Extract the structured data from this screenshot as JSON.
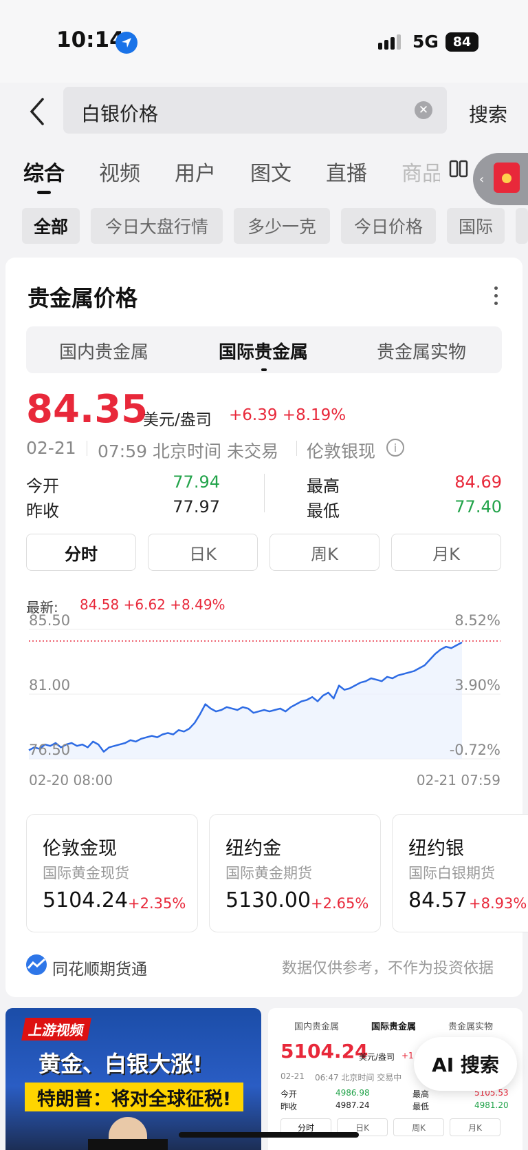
{
  "status_bar": {
    "time": "10:14",
    "network": "5G",
    "battery": "84"
  },
  "search": {
    "query": "白银价格",
    "submit_label": "搜索"
  },
  "tabs": [
    {
      "label": "综合",
      "active": true
    },
    {
      "label": "视频"
    },
    {
      "label": "用户"
    },
    {
      "label": "图文"
    },
    {
      "label": "直播"
    },
    {
      "label": "商品"
    }
  ],
  "chips": [
    {
      "label": "全部",
      "active": true
    },
    {
      "label": "今日大盘行情"
    },
    {
      "label": "多少一克"
    },
    {
      "label": "今日价格"
    },
    {
      "label": "国际"
    }
  ],
  "card": {
    "title": "贵金属价格",
    "segments": [
      "国内贵金属",
      "国际贵金属",
      "贵金属实物"
    ],
    "active_segment": "国际贵金属",
    "price": "84.35",
    "unit": "美元/盎司",
    "change": "+6.39 +8.19%",
    "date": "02-21",
    "time_status": "07:59 北京时间 未交易",
    "instrument": "伦敦银现",
    "stats": {
      "open_label": "今开",
      "open": "77.94",
      "prev_close_label": "昨收",
      "prev_close": "77.97",
      "high_label": "最高",
      "high": "84.69",
      "low_label": "最低",
      "low": "77.40"
    },
    "periods": [
      "分时",
      "日K",
      "周K",
      "月K"
    ],
    "active_period": "分时",
    "latest_label": "最新:",
    "latest_value": "84.58 +6.62 +8.49%",
    "footer_source": "同花顺期货通",
    "footer_note": "数据仅供参考，不作为投资依据"
  },
  "chart_data": {
    "type": "line",
    "x_start": "02-20 08:00",
    "x_end": "02-21 07:59",
    "y_ticks": [
      "85.50",
      "81.00",
      "76.50"
    ],
    "y_right_ticks": [
      "8.52%",
      "3.90%",
      "-0.72%"
    ],
    "ylim": [
      76.5,
      85.5
    ],
    "reference_line": 84.69,
    "series": [
      {
        "values": [
          77.1,
          77.3,
          77.2,
          77.5,
          77.4,
          77.6,
          77.3,
          77.5,
          77.6,
          77.4,
          77.5,
          77.3,
          77.7,
          77.5,
          77.0,
          77.3,
          77.4,
          77.5,
          77.6,
          77.8,
          77.7,
          77.9,
          78.0,
          78.1,
          78.0,
          78.2,
          78.3,
          78.2,
          78.5,
          78.4,
          78.6,
          79.0,
          79.6,
          80.3,
          80.0,
          79.8,
          79.9,
          80.1,
          80.0,
          79.9,
          80.1,
          80.0,
          79.7,
          79.8,
          79.9,
          79.8,
          79.9,
          80.0,
          79.8,
          80.1,
          80.3,
          80.5,
          80.6,
          80.8,
          80.5,
          80.9,
          81.1,
          80.7,
          81.6,
          81.3,
          81.4,
          81.6,
          81.8,
          81.9,
          82.1,
          82.0,
          81.9,
          82.2,
          82.1,
          82.3,
          82.4,
          82.5,
          82.6,
          82.8,
          83.0,
          83.4,
          83.8,
          84.1,
          84.3,
          84.2,
          84.4,
          84.6
        ]
      }
    ]
  },
  "markets": [
    {
      "title": "伦敦金现",
      "subtitle": "国际黄金现货",
      "value": "5104.24",
      "pct": "+2.35%"
    },
    {
      "title": "纽约金",
      "subtitle": "国际黄金期货",
      "value": "5130.00",
      "pct": "+2.65%"
    },
    {
      "title": "纽约银",
      "subtitle": "国际白银期货",
      "value": "84.57",
      "pct": "+8.93%"
    }
  ],
  "result_video": {
    "badge": "上游视频",
    "headline": "黄金、白银大涨!",
    "subline": "特朗普：将对全球征税!"
  },
  "result_preview": {
    "segments": [
      "国内贵金属",
      "国际贵金属",
      "贵金属实物"
    ],
    "price": "5104.24",
    "unit": "美元/盎司",
    "change": "+1",
    "date": "02-21",
    "time_status": "06:47 北京时间 交易中",
    "open_label": "今开",
    "open": "4986.98",
    "prev_close_label": "昨收",
    "prev_close": "4987.24",
    "high_label": "最高",
    "high": "5105.53",
    "low_label": "最低",
    "low": "4981.20",
    "periods": [
      "分时",
      "日K",
      "周K",
      "月K"
    ]
  },
  "ai_button": {
    "label": "AI 搜索"
  },
  "colors": {
    "up": "#e8283a",
    "down": "#22a34a",
    "line": "#2d6be4"
  }
}
